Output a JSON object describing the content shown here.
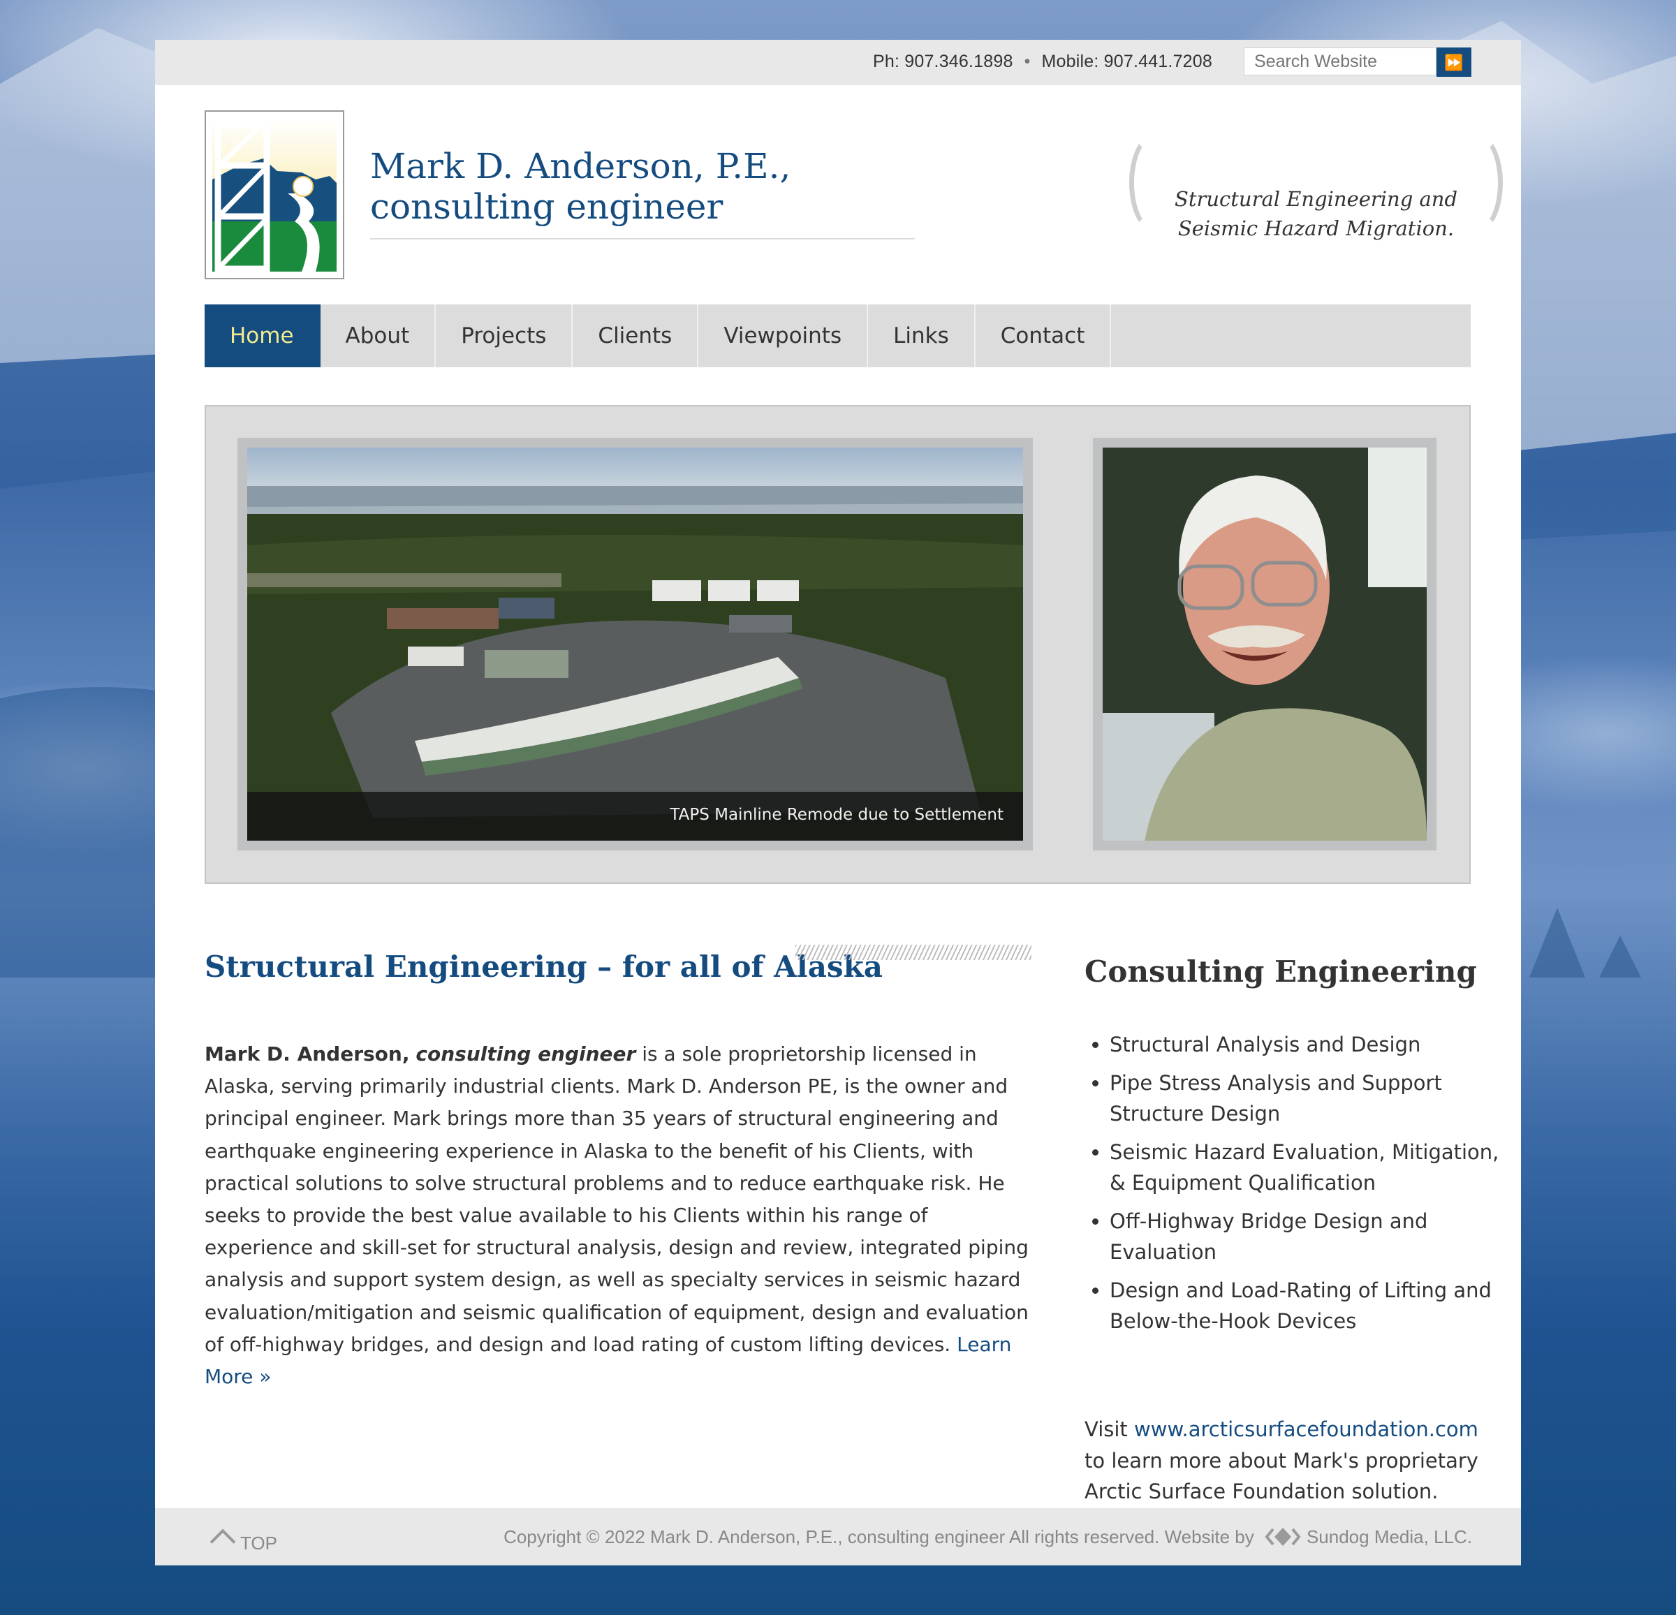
{
  "topbar": {
    "phone": "Ph: 907.346.1898",
    "separator": "•",
    "mobile": "Mobile: 907.441.7208",
    "search_placeholder": "Search Website",
    "search_button_icon": "double-chevron-right-icon"
  },
  "header": {
    "title_line1": "Mark D. Anderson, P.E.,",
    "title_line2": "consulting engineer",
    "tagline_line1": "Structural Engineering and",
    "tagline_line2": "Seismic Hazard Migration."
  },
  "nav": {
    "items": [
      {
        "label": "Home",
        "active": true
      },
      {
        "label": "About"
      },
      {
        "label": "Projects"
      },
      {
        "label": "Clients"
      },
      {
        "label": "Viewpoints"
      },
      {
        "label": "Links"
      },
      {
        "label": "Contact"
      }
    ]
  },
  "slider": {
    "caption": "TAPS Mainline Remode due to Settlement"
  },
  "main": {
    "title": "Structural Engineering – for all of Alaska",
    "intro_bold": "Mark D. Anderson,",
    "intro_italic": "consulting engineer",
    "body": " is a sole proprietorship licensed in Alaska, serving primarily industrial clients. Mark D. Anderson PE, is the owner and principal engineer. Mark brings more than 35 years of structural engineering and earthquake engineering experience in Alaska to the benefit of his Clients, with practical solutions to solve structural problems and to reduce earthquake risk. He seeks to provide the best value available to his Clients within his range of experience and skill-set for structural analysis, design and review, integrated piping analysis and support system design, as well as specialty services in seismic hazard evaluation/mitigation and seismic qualification of equipment, design and evaluation of off-highway bridges, and design and load rating of custom lifting devices. ",
    "learn_more": "Learn More »"
  },
  "sidebar": {
    "title": "Consulting Engineering",
    "services": [
      "Structural Analysis and Design",
      "Pipe Stress Analysis and Support Structure Design",
      "Seismic Hazard Evaluation, Mitigation, & Equipment Qualification",
      "Off-Highway Bridge Design and Evaluation",
      "Design and Load-Rating of Lifting and Below-the-Hook Devices"
    ],
    "visit_prefix": "Visit ",
    "visit_link": "www.arcticsurfacefoundation.com",
    "visit_suffix": " to learn more about Mark's proprietary Arctic Surface Foundation solution."
  },
  "footer": {
    "top_label": "TOP",
    "copyright": "Copyright © 2022 Mark D. Anderson, P.E., consulting engineer All rights reserved. Website by",
    "credit": "Sundog Media, LLC."
  },
  "colors": {
    "brand_blue": "#154c80",
    "nav_active_text": "#f3ec8f",
    "nav_bg": "#dcdcdd",
    "text": "#333333"
  }
}
